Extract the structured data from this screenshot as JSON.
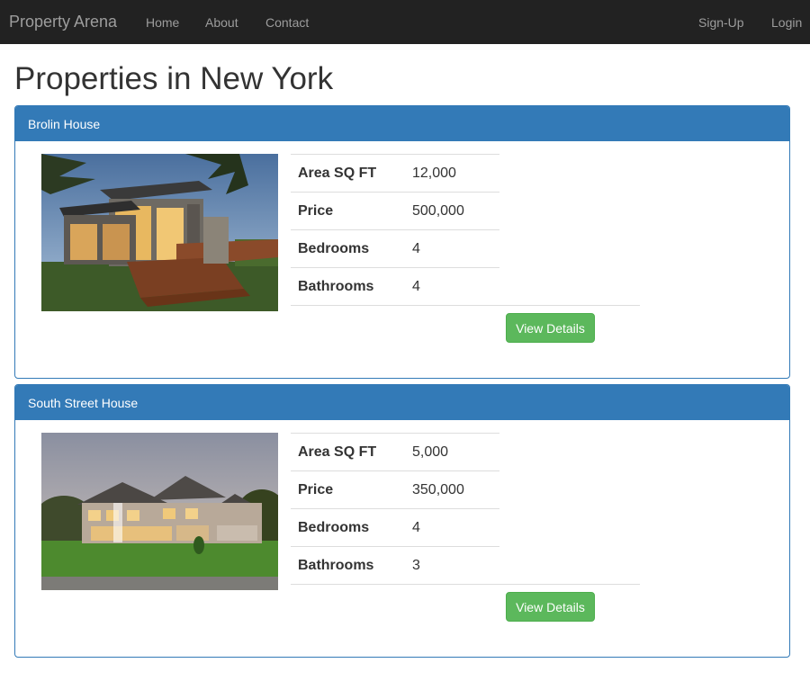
{
  "navbar": {
    "brand": "Property Arena",
    "links": [
      "Home",
      "About",
      "Contact"
    ],
    "right_links": [
      "Sign-Up",
      "Login"
    ],
    "background": "#222222"
  },
  "page": {
    "title": "Properties in New York"
  },
  "properties": [
    {
      "name": "Brolin House",
      "specs": [
        {
          "label": "Area SQ FT",
          "value": "12,000"
        },
        {
          "label": "Price",
          "value": "500,000"
        },
        {
          "label": "Bedrooms",
          "value": "4"
        },
        {
          "label": "Bathrooms",
          "value": "4"
        }
      ],
      "button": "View Details"
    },
    {
      "name": "South Street House",
      "specs": [
        {
          "label": "Area SQ FT",
          "value": "5,000"
        },
        {
          "label": "Price",
          "value": "350,000"
        },
        {
          "label": "Bedrooms",
          "value": "4"
        },
        {
          "label": "Bathrooms",
          "value": "3"
        }
      ],
      "button": "View Details"
    }
  ],
  "colors": {
    "panel_primary": "#337ab7",
    "button_success": "#5cb85c"
  }
}
